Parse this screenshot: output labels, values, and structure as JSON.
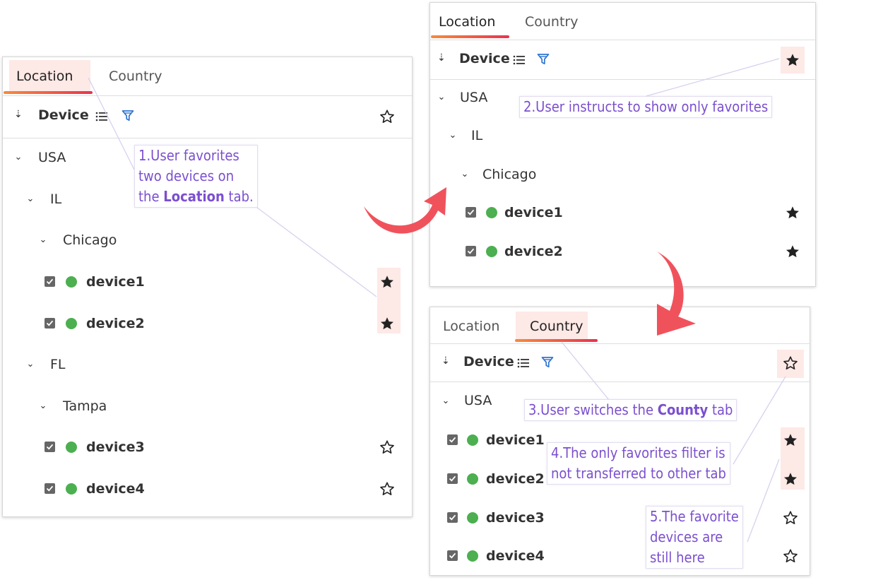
{
  "tabs": {
    "location": "Location",
    "country": "Country"
  },
  "toolbar": {
    "device_label": "Device"
  },
  "tree": {
    "usa": "USA",
    "il": "IL",
    "chicago": "Chicago",
    "fl": "FL",
    "tampa": "Tampa",
    "device1": "device1",
    "device2": "device2",
    "device3": "device3",
    "device4": "device4"
  },
  "annotations": {
    "note1": {
      "line1": "1.User favorites",
      "line2": "two devices on",
      "line3_pre": "the ",
      "line3_bold": "Location",
      "line3_post": " tab."
    },
    "note2": "2.User instructs to show only favorites",
    "note3": {
      "pre": "3.User switches the ",
      "bold": "County",
      "post": " tab"
    },
    "note4": {
      "line1": "4.The only favorites filter is",
      "line2": "not transferred to other tab"
    },
    "note5": {
      "line1": "5.The favorite",
      "line2": "devices are",
      "line3": "still here"
    }
  },
  "colors": {
    "accent_from": "#f58b3c",
    "accent_to": "#e8334f",
    "highlight": "#fde9e6",
    "arrow": "#f0525c",
    "note_text": "#7b4fcf",
    "status_dot": "#4caf50",
    "filter_icon": "#2f74d0"
  },
  "icons": [
    "double-chevron-down-icon",
    "list-icon",
    "filter-icon",
    "star-outline-icon",
    "star-filled-icon",
    "chevron-down-icon",
    "checkbox-checked-icon",
    "status-dot-icon",
    "curved-arrow-icon"
  ]
}
